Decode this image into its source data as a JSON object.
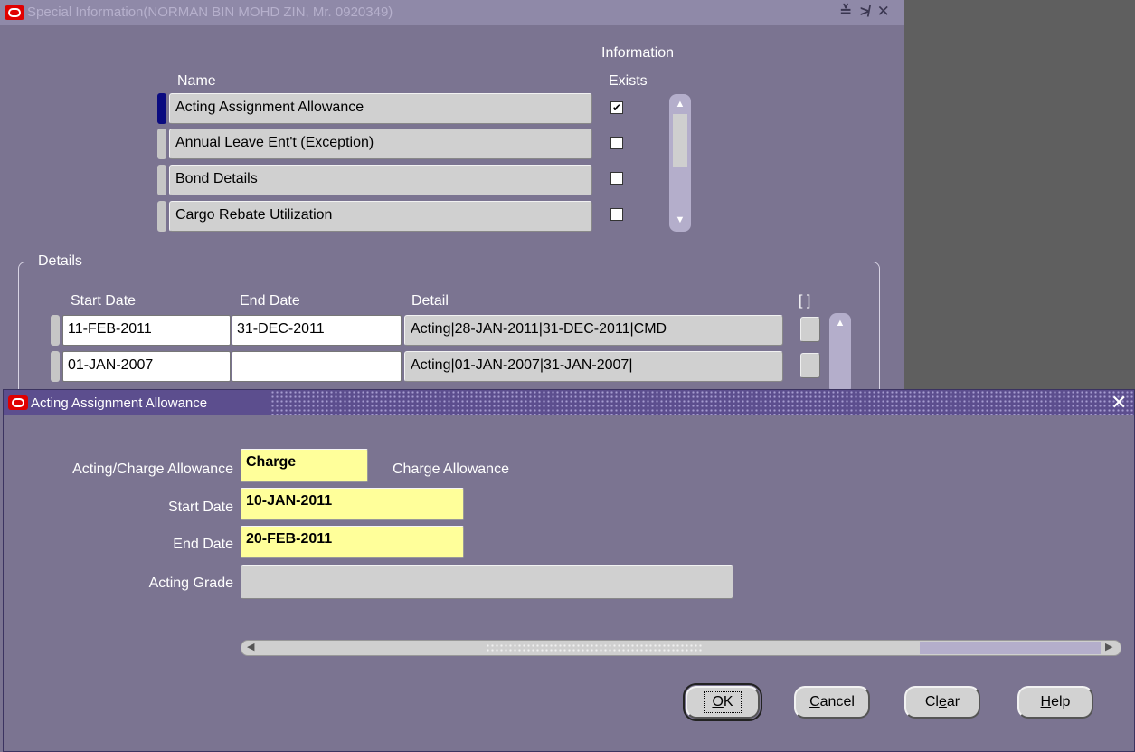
{
  "bg_window": {
    "title": "Special Information(NORMAN BIN MOHD ZIN, Mr. 0920349)",
    "controls": "≚ ≯ ✕",
    "col_name": "Name",
    "col_info_line1": "Information",
    "col_info_line2": "Exists",
    "rows": [
      {
        "name": "Acting Assignment Allowance",
        "exists": true
      },
      {
        "name": "Annual Leave Ent't (Exception)",
        "exists": false
      },
      {
        "name": "Bond Details",
        "exists": false
      },
      {
        "name": "Cargo Rebate Utilization",
        "exists": false
      }
    ],
    "details": {
      "legend": "Details",
      "col_start": "Start Date",
      "col_end": "End Date",
      "col_detail": "Detail",
      "col_flex": "[ ]",
      "rows": [
        {
          "start": "11-FEB-2011",
          "end": "31-DEC-2011",
          "detail": "Acting|28-JAN-2011|31-DEC-2011|CMD"
        },
        {
          "start": "01-JAN-2007",
          "end": "",
          "detail": "Acting|01-JAN-2007|31-JAN-2007|"
        }
      ]
    }
  },
  "dialog": {
    "title": "Acting Assignment Allowance",
    "close": "✕",
    "fields": {
      "acting_charge_label": "Acting/Charge Allowance",
      "acting_charge_value": "Charge",
      "acting_charge_desc": "Charge Allowance",
      "start_date_label": "Start Date",
      "start_date_value": "10-JAN-2011",
      "end_date_label": "End Date",
      "end_date_value": "20-FEB-2011",
      "acting_grade_label": "Acting Grade",
      "acting_grade_value": ""
    },
    "buttons": {
      "ok_mnemonic": "O",
      "ok_rest": "K",
      "cancel_mnemonic": "C",
      "cancel_rest": "ancel",
      "clear_pre": "Cl",
      "clear_mnemonic": "e",
      "clear_rest": "ar",
      "help_mnemonic": "H",
      "help_rest": "elp"
    }
  },
  "colors": {
    "window_bg": "#7b7491",
    "required_field": "#ffff9a",
    "titlebar_active": "#5c4e8e"
  }
}
